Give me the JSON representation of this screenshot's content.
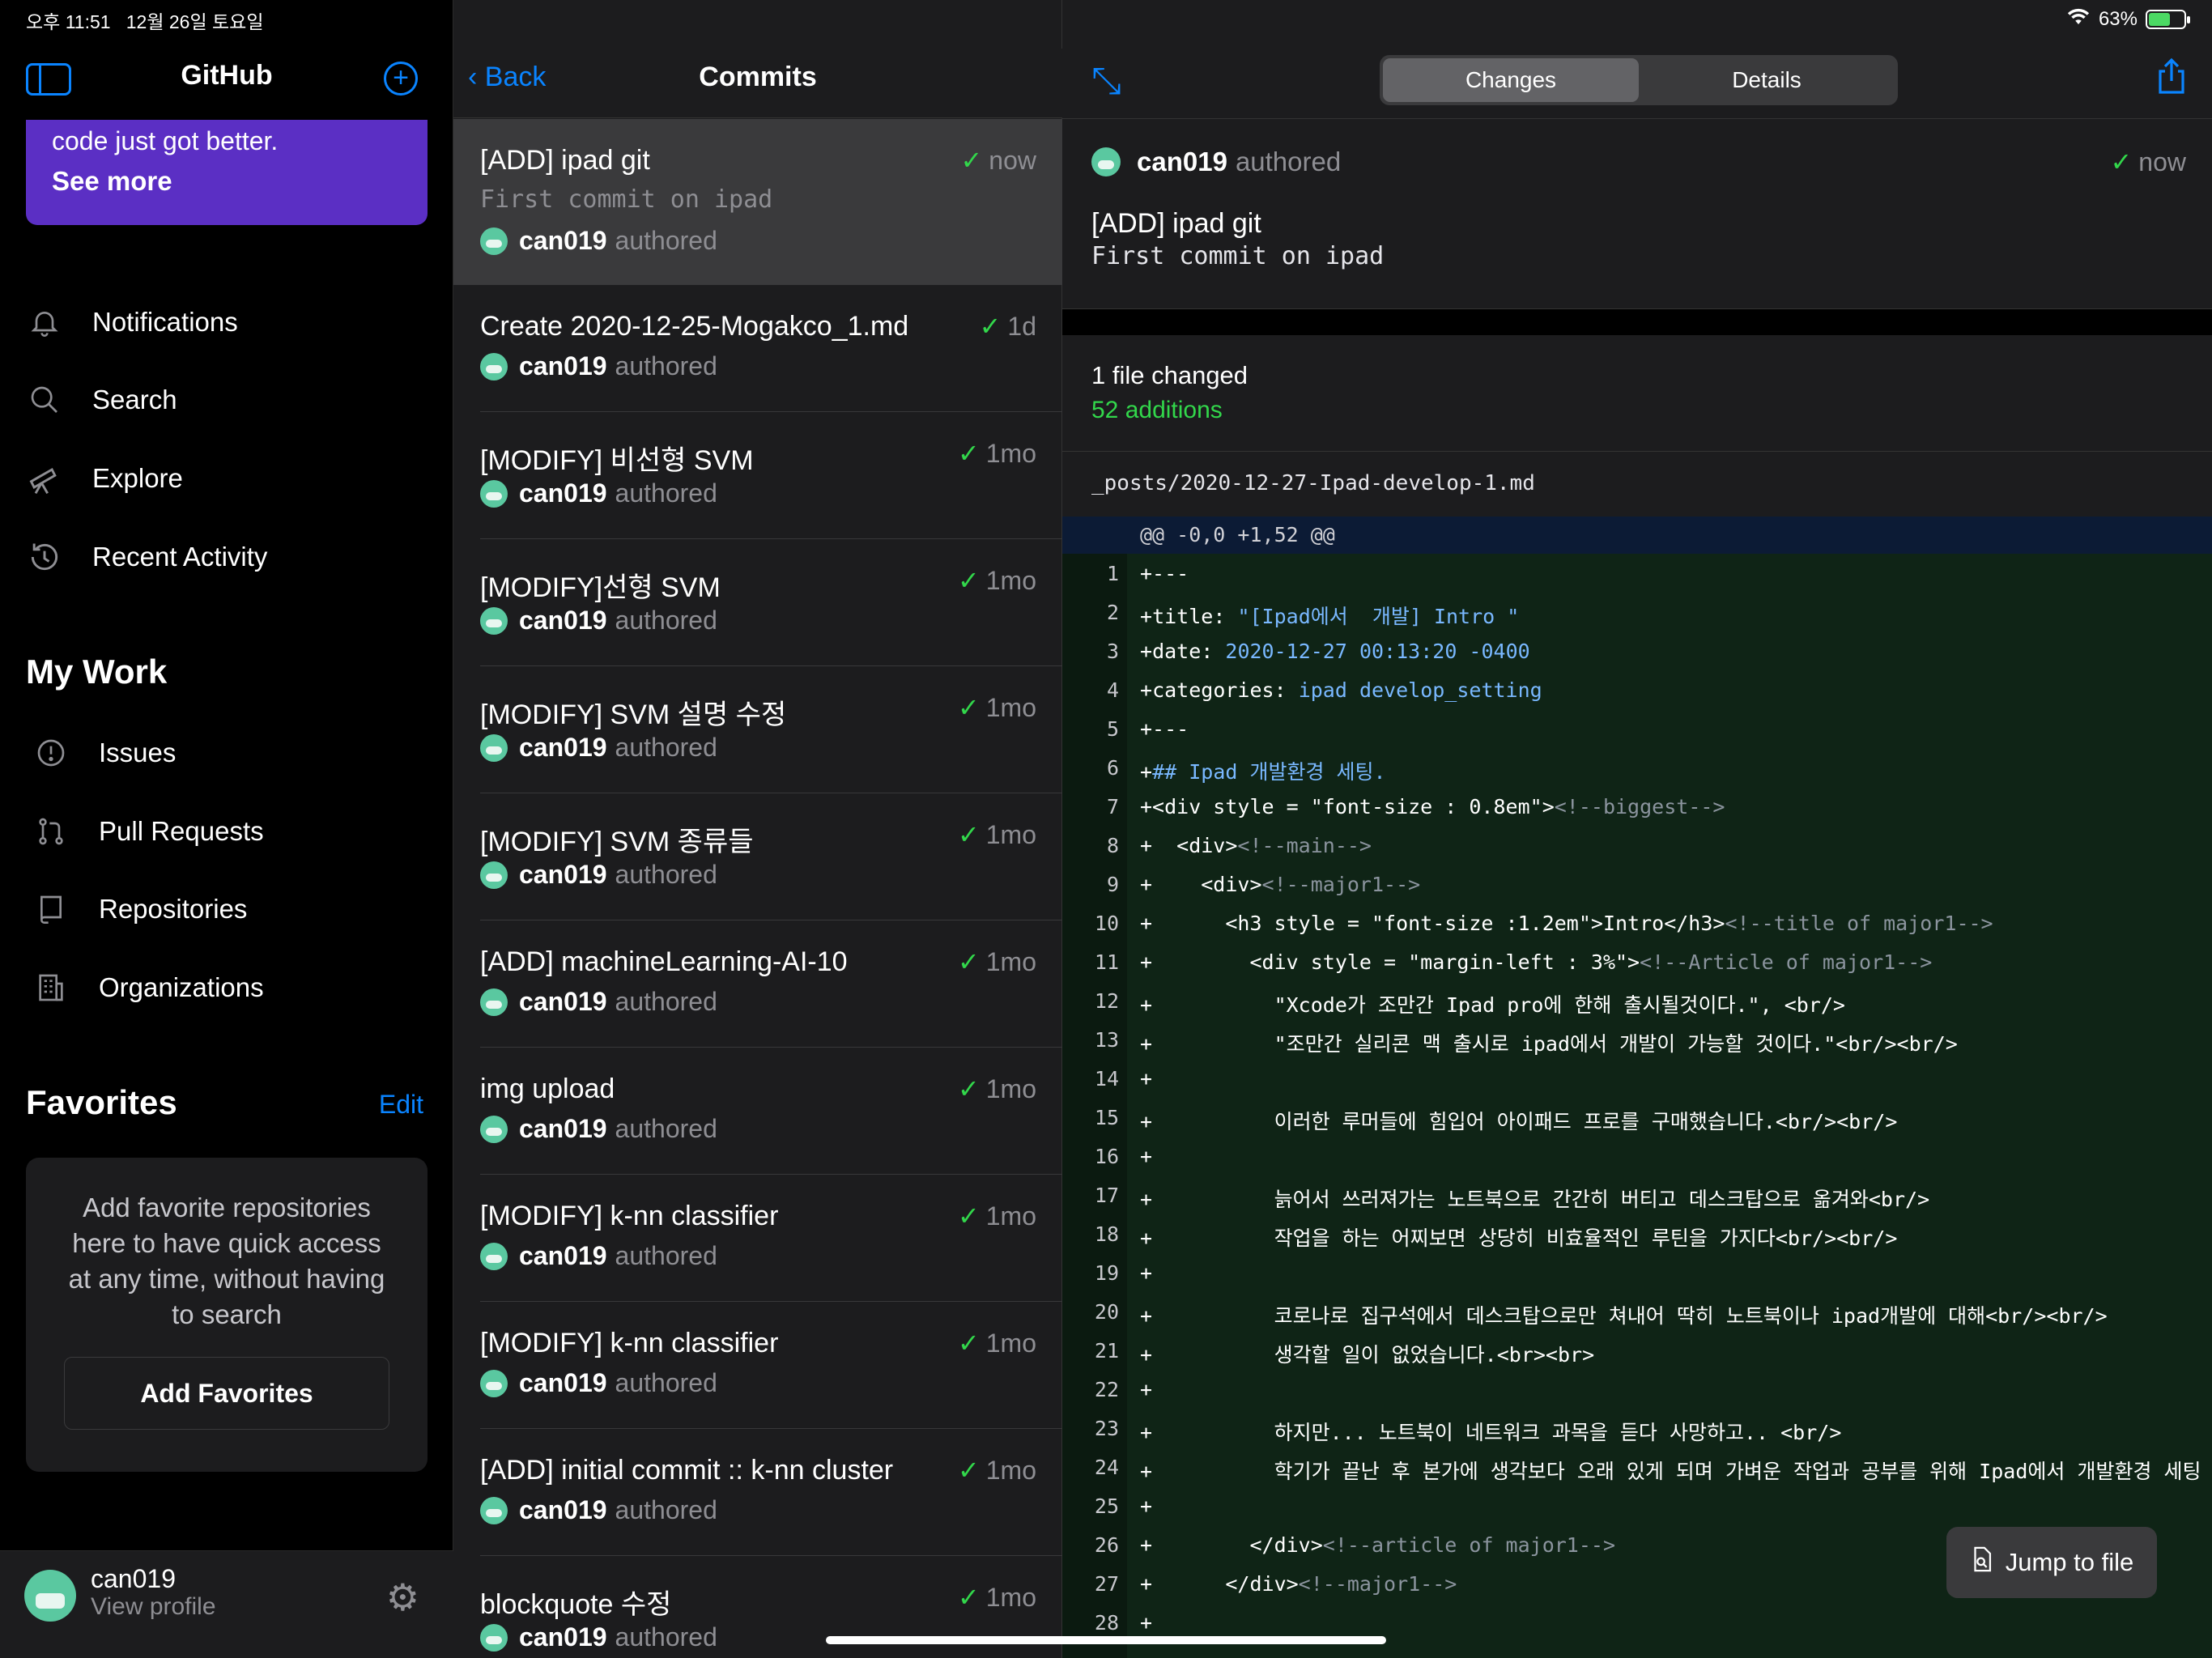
{
  "status_bar": {
    "time": "오후 11:51",
    "date": "12월 26일 토요일",
    "battery_text": "63%",
    "battery_level": 0.63
  },
  "sidebar": {
    "title": "GitHub",
    "promo": {
      "text": "code just got better.",
      "link": "See more"
    },
    "nav": [
      {
        "label": "Notifications",
        "icon": "bell-icon"
      },
      {
        "label": "Search",
        "icon": "search-icon"
      },
      {
        "label": "Explore",
        "icon": "telescope-icon"
      },
      {
        "label": "Recent Activity",
        "icon": "history-icon"
      }
    ],
    "my_work_title": "My Work",
    "my_work": [
      {
        "label": "Issues",
        "icon": "issue-icon"
      },
      {
        "label": "Pull Requests",
        "icon": "pull-request-icon"
      },
      {
        "label": "Repositories",
        "icon": "repo-icon"
      },
      {
        "label": "Organizations",
        "icon": "organization-icon"
      }
    ],
    "favorites_title": "Favorites",
    "favorites_edit": "Edit",
    "favorites_empty": "Add favorite repositories here to have quick access at any time, without having to search",
    "favorites_button": "Add Favorites",
    "profile": {
      "name": "can019",
      "sub": "View profile"
    }
  },
  "commits_pane": {
    "back": "Back",
    "title": "Commits",
    "authored_label": "authored",
    "items": [
      {
        "title": "[ADD] ipad git",
        "message": "First commit on ipad",
        "author": "can019",
        "time": "now"
      },
      {
        "title": "Create 2020-12-25-Mogakco_1.md",
        "author": "can019",
        "time": "1d"
      },
      {
        "title": "[MODIFY] 비선형 SVM",
        "author": "can019",
        "time": "1mo"
      },
      {
        "title": "[MODIFY]선형 SVM",
        "author": "can019",
        "time": "1mo"
      },
      {
        "title": "[MODIFY] SVM 설명 수정",
        "author": "can019",
        "time": "1mo"
      },
      {
        "title": "[MODIFY] SVM 종류들",
        "author": "can019",
        "time": "1mo"
      },
      {
        "title": "[ADD] machineLearning-AI-10",
        "author": "can019",
        "time": "1mo"
      },
      {
        "title": "img upload",
        "author": "can019",
        "time": "1mo"
      },
      {
        "title": "[MODIFY] k-nn classifier",
        "author": "can019",
        "time": "1mo"
      },
      {
        "title": "[MODIFY] k-nn classifier",
        "author": "can019",
        "time": "1mo"
      },
      {
        "title": "[ADD] initial commit :: k-nn cluster",
        "author": "can019",
        "time": "1mo"
      },
      {
        "title": "blockquote 수정",
        "author": "can019",
        "time": "1mo"
      }
    ]
  },
  "detail": {
    "tabs": [
      "Changes",
      "Details"
    ],
    "author": "can019",
    "authored_label": "authored",
    "time": "now",
    "title": "[ADD] ipad git",
    "message": "First commit on ipad",
    "files_changed": "1 file changed",
    "additions": "52 additions",
    "file_path": "_posts/2020-12-27-Ipad-develop-1.md",
    "hunk": "@@ -0,0 +1,52 @@",
    "lines": [
      {
        "n": "1",
        "c": "+---"
      },
      {
        "n": "2",
        "c": "+title: \"[Ipad에서  개발] Intro \""
      },
      {
        "n": "3",
        "c": "+date: 2020-12-27 00:13:20 -0400"
      },
      {
        "n": "4",
        "c": "+categories: ipad develop_setting"
      },
      {
        "n": "5",
        "c": "+---"
      },
      {
        "n": "6",
        "c": "+## Ipad 개발환경 세팅."
      },
      {
        "n": "7",
        "c": "+<div style = \"font-size : 0.8em\"><!--biggest-->"
      },
      {
        "n": "8",
        "c": "+  <div><!--main-->"
      },
      {
        "n": "9",
        "c": "+    <div><!--major1-->"
      },
      {
        "n": "10",
        "c": "+      <h3 style = \"font-size :1.2em\">Intro</h3><!--title of major1-->"
      },
      {
        "n": "11",
        "c": "+        <div style = \"margin-left : 3%\"><!--Article of major1-->"
      },
      {
        "n": "12",
        "c": "+          \"Xcode가 조만간 Ipad pro에 한해 출시될것이다.\", <br/>"
      },
      {
        "n": "13",
        "c": "+          \"조만간 실리콘 맥 출시로 ipad에서 개발이 가능할 것이다.\"<br/><br/>"
      },
      {
        "n": "14",
        "c": "+"
      },
      {
        "n": "15",
        "c": "+          이러한 루머들에 힘입어 아이패드 프로를 구매했습니다.<br/><br/>"
      },
      {
        "n": "16",
        "c": "+"
      },
      {
        "n": "17",
        "c": "+          늙어서 쓰러져가는 노트북으로 간간히 버티고 데스크탑으로 옮겨와<br/>"
      },
      {
        "n": "18",
        "c": "+          작업을 하는 어찌보면 상당히 비효율적인 루틴을 가지다<br/><br/>"
      },
      {
        "n": "19",
        "c": "+"
      },
      {
        "n": "20",
        "c": "+          코로나로 집구석에서 데스크탑으로만 쳐내어 딱히 노트북이나 ipad개발에 대해<br/><br/>"
      },
      {
        "n": "21",
        "c": "+          생각할 일이 없었습니다.<br><br>"
      },
      {
        "n": "22",
        "c": "+"
      },
      {
        "n": "23",
        "c": "+          하지만... 노트북이 네트워크 과목을 듣다 사망하고.. <br/>"
      },
      {
        "n": "24",
        "c": "+          학기가 끝난 후 본가에 생각보다 오래 있게 되며 가벼운 작업과 공부를 위해 Ipad에서 개발환경 세팅"
      },
      {
        "n": "25",
        "c": "+"
      },
      {
        "n": "26",
        "c": "+        </div><!--article of major1-->"
      },
      {
        "n": "27",
        "c": "+      </div><!--major1-->"
      },
      {
        "n": "28",
        "c": "+"
      }
    ],
    "jump_button": "Jump to file"
  }
}
